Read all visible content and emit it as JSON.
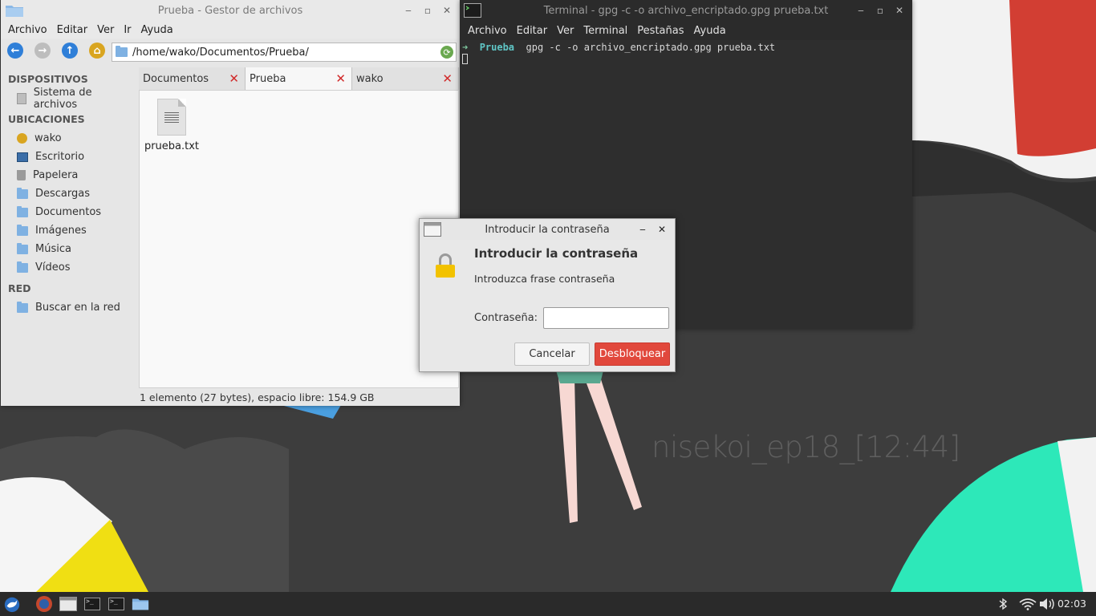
{
  "wallpaper": {
    "text": "nisekoi_ep18_[12:44]"
  },
  "file_manager": {
    "title": "Prueba - Gestor de archivos",
    "menu": [
      "Archivo",
      "Editar",
      "Ver",
      "Ir",
      "Ayuda"
    ],
    "location": "/home/wako/Documentos/Prueba/",
    "sidebar": {
      "devices_heading": "DISPOSITIVOS",
      "devices": [
        "Sistema de archivos"
      ],
      "places_heading": "UBICACIONES",
      "places": [
        "wako",
        "Escritorio",
        "Papelera",
        "Descargas",
        "Documentos",
        "Imágenes",
        "Música",
        "Vídeos"
      ],
      "network_heading": "RED",
      "network": [
        "Buscar en la red"
      ]
    },
    "tabs": [
      "Documentos",
      "Prueba",
      "wako"
    ],
    "files": [
      "prueba.txt"
    ],
    "status": "1 elemento (27 bytes), espacio libre: 154.9 GB"
  },
  "terminal": {
    "title": "Terminal - gpg -c -o archivo_encriptado.gpg prueba.txt",
    "menu": [
      "Archivo",
      "Editar",
      "Ver",
      "Terminal",
      "Pestañas",
      "Ayuda"
    ],
    "prompt_arrow": "➜",
    "prompt_dir": "Prueba",
    "command": "gpg -c -o archivo_encriptado.gpg prueba.txt"
  },
  "dialog": {
    "title": "Introducir la contraseña",
    "heading": "Introducir la contraseña",
    "description": "Introduzca frase contraseña",
    "password_label": "Contraseña:",
    "password_value": "",
    "cancel_label": "Cancelar",
    "unlock_label": "Desbloquear"
  },
  "taskbar": {
    "clock": "02:03"
  },
  "colors": {
    "accent_red": "#e1483c",
    "lock_yellow": "#f2c200",
    "folder_blue": "#7fb1e2"
  }
}
